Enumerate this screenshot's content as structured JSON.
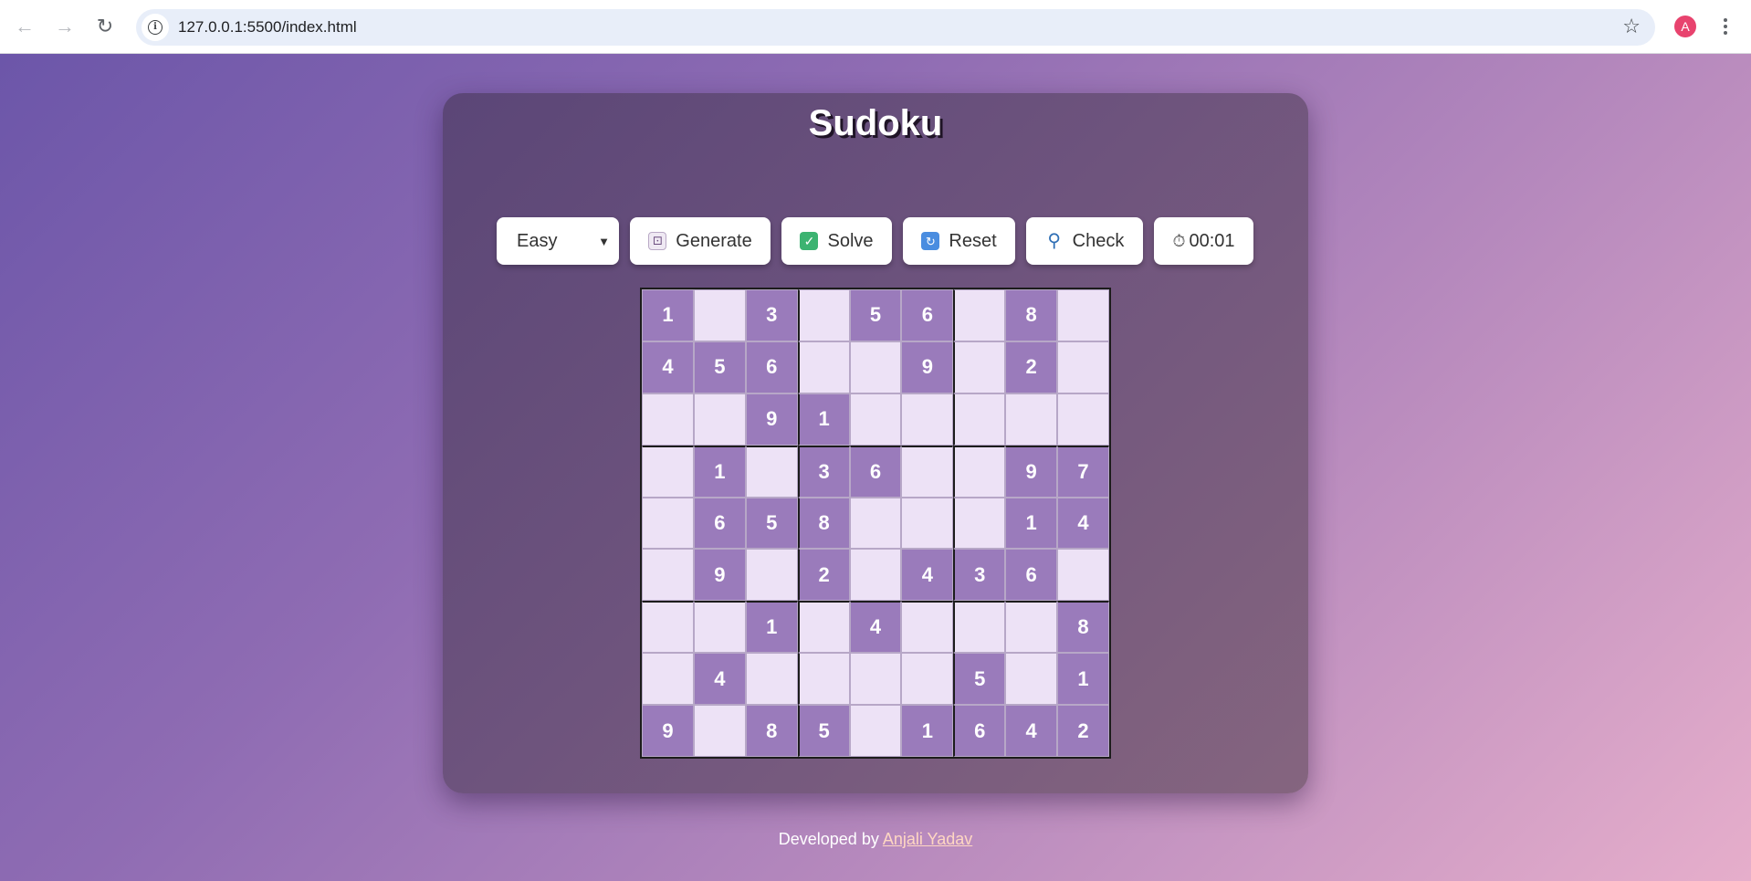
{
  "browser": {
    "url": "127.0.0.1:5500/index.html",
    "avatar_initial": "A",
    "icons": [
      "back-arrow-icon",
      "forward-arrow-icon",
      "reload-icon",
      "info-icon",
      "star-icon",
      "menu-dots-icon"
    ]
  },
  "app": {
    "title": "Sudoku",
    "difficulty": "Easy",
    "buttons": {
      "generate": "Generate",
      "solve": "Solve",
      "reset": "Reset",
      "check": "Check"
    },
    "timer": "00:01"
  },
  "board": [
    [
      "1",
      "",
      "3",
      "",
      "5",
      "6",
      "",
      "8",
      ""
    ],
    [
      "4",
      "5",
      "6",
      "",
      "",
      "9",
      "",
      "2",
      ""
    ],
    [
      "",
      "",
      "9",
      "1",
      "",
      "",
      "",
      "",
      ""
    ],
    [
      "",
      "1",
      "",
      "3",
      "6",
      "",
      "",
      "9",
      "7"
    ],
    [
      "",
      "6",
      "5",
      "8",
      "",
      "",
      "",
      "1",
      "4"
    ],
    [
      "",
      "9",
      "",
      "2",
      "",
      "4",
      "3",
      "6",
      ""
    ],
    [
      "",
      "",
      "1",
      "",
      "4",
      "",
      "",
      "",
      "8"
    ],
    [
      "",
      "4",
      "",
      "",
      "",
      "",
      "5",
      "",
      "1"
    ],
    [
      "9",
      "",
      "8",
      "5",
      "",
      "1",
      "6",
      "4",
      "2"
    ]
  ],
  "footer": {
    "prefix": "Developed by",
    "author": "Anjali Yadav"
  },
  "colors": {
    "given_cell": "#9a7bbb",
    "empty_cell": "#ede2f6"
  }
}
